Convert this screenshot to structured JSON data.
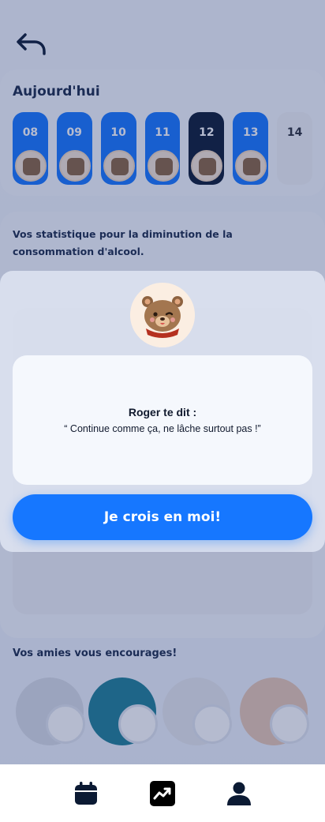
{
  "header": {
    "back_icon": "undo-arrow-icon"
  },
  "today": {
    "title": "Aujourd'hui",
    "days": [
      {
        "num": "08",
        "state": "done"
      },
      {
        "num": "09",
        "state": "done"
      },
      {
        "num": "10",
        "state": "done"
      },
      {
        "num": "11",
        "state": "done"
      },
      {
        "num": "12",
        "state": "current"
      },
      {
        "num": "13",
        "state": "done"
      },
      {
        "num": "14",
        "state": "future"
      }
    ]
  },
  "stats": {
    "description": "Vos statistique pour la diminution de la consommation d'alcool."
  },
  "friends": {
    "title": "Vos amies vous encourages!"
  },
  "modal": {
    "title": "Roger te dit :",
    "quote": "“ Continue comme ça, ne lâche surtout pas !”",
    "cta_label": "Je crois en moi!"
  },
  "nav": {
    "items": [
      {
        "icon": "calendar-icon"
      },
      {
        "icon": "trending-up-icon"
      },
      {
        "icon": "user-icon"
      }
    ]
  },
  "colors": {
    "accent": "#1677ff",
    "dark": "#0b1a33"
  }
}
